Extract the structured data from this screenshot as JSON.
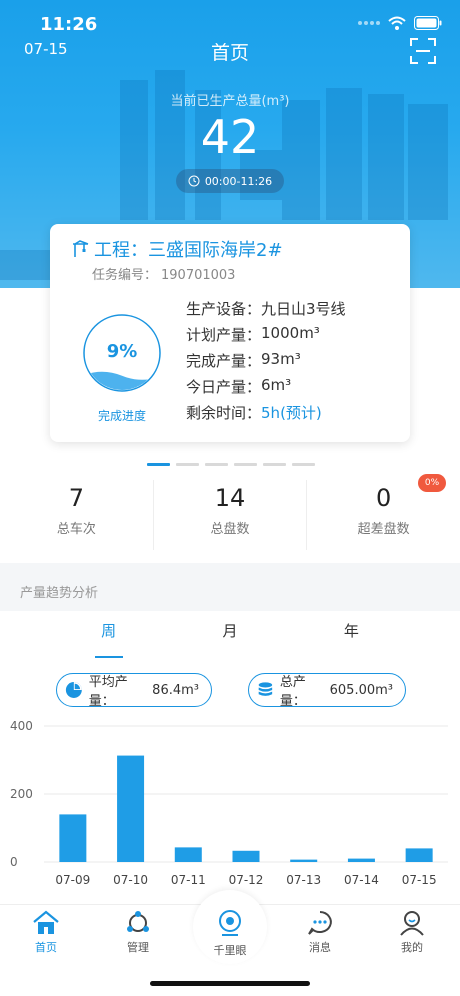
{
  "status": {
    "time": "11:26"
  },
  "header": {
    "date": "07-15",
    "title": "首页"
  },
  "current": {
    "label": "当前已生产总量(m³)",
    "value": "42",
    "time_range": "00:00-11:26"
  },
  "project": {
    "title": "工程：三盛国际海岸2#",
    "task_label": "任务编号：",
    "task_no": "190701003",
    "progress_percent": 9,
    "progress_text": "9%",
    "progress_label": "完成进度",
    "info": [
      {
        "label": "生产设备：",
        "value": "九日山3号线",
        "accent": false
      },
      {
        "label": "计划产量：",
        "value": "1000m³",
        "accent": false
      },
      {
        "label": "完成产量：",
        "value": "93m³",
        "accent": false
      },
      {
        "label": "今日产量：",
        "value": "6m³",
        "accent": false
      },
      {
        "label": "剩余时间：",
        "value": "5h(预计)",
        "accent": true
      }
    ]
  },
  "pager": {
    "count": 6,
    "active": 0
  },
  "stats": [
    {
      "value": "7",
      "label": "总车次"
    },
    {
      "value": "14",
      "label": "总盘数"
    },
    {
      "value": "0",
      "label": "超差盘数",
      "badge": "0%"
    }
  ],
  "trend": {
    "section_title": "产量趋势分析",
    "tabs": [
      "周",
      "月",
      "年"
    ],
    "active_tab": 0,
    "avg_label": "平均产量：",
    "avg_value": "86.4m³",
    "total_label": "总产量：",
    "total_value": "605.00m³"
  },
  "chart_data": {
    "type": "bar",
    "categories": [
      "07-09",
      "07-10",
      "07-11",
      "07-12",
      "07-13",
      "07-14",
      "07-15"
    ],
    "values": [
      140,
      313,
      43,
      33,
      7,
      10,
      40
    ],
    "ylim": [
      0,
      400
    ],
    "yticks": [
      0,
      200,
      400
    ],
    "grid": true,
    "color": "#1f9de6"
  },
  "tabbar": {
    "items": [
      {
        "label": "首页",
        "icon": "home-icon",
        "active": true
      },
      {
        "label": "管理",
        "icon": "management-icon",
        "active": false
      },
      {
        "label": "千里眼",
        "icon": "camera-icon",
        "active": false
      },
      {
        "label": "消息",
        "icon": "message-icon",
        "active": false
      },
      {
        "label": "我的",
        "icon": "profile-icon",
        "active": false
      }
    ]
  },
  "colors": {
    "accent": "#1a94e0",
    "badge": "#f0593e"
  }
}
